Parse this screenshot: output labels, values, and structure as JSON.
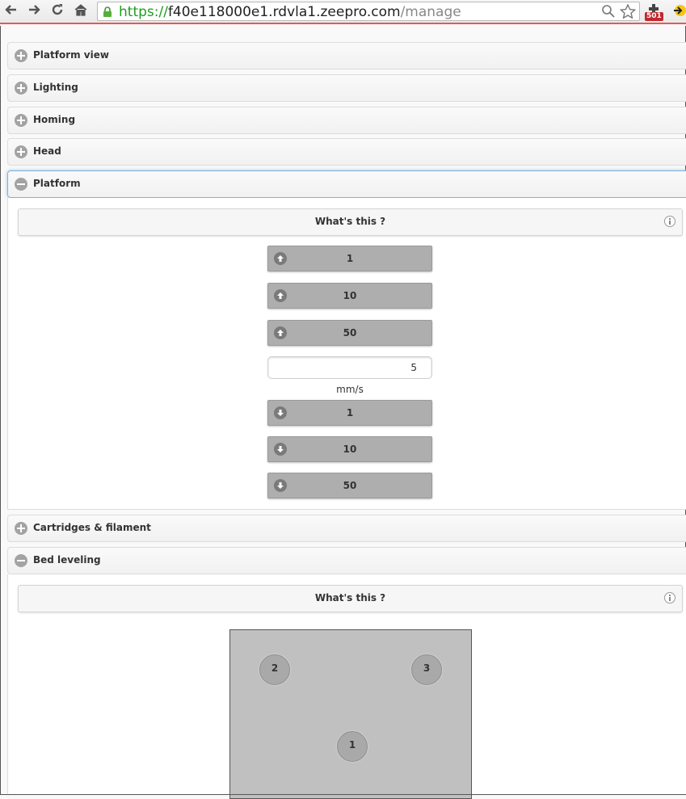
{
  "browser": {
    "url_scheme": "https://",
    "url_host": "f40e118000e1.rdvla1.zeepro.com",
    "url_path": "/manage",
    "extension_badge": "501"
  },
  "panels": [
    {
      "title": "Platform view",
      "state": "collapsed"
    },
    {
      "title": "Lighting",
      "state": "collapsed"
    },
    {
      "title": "Homing",
      "state": "collapsed"
    },
    {
      "title": "Head",
      "state": "collapsed"
    },
    {
      "title": "Platform",
      "state": "expanded"
    },
    {
      "title": "Cartridges & filament",
      "state": "collapsed"
    },
    {
      "title": "Bed leveling",
      "state": "expanded"
    }
  ],
  "platform": {
    "help_label": "What's this ?",
    "up_buttons": [
      "1",
      "10",
      "50"
    ],
    "speed_value": "5",
    "speed_unit": "mm/s",
    "down_buttons": [
      "1",
      "10",
      "50"
    ]
  },
  "bed_leveling": {
    "help_label": "What's this ?",
    "points": [
      "2",
      "3",
      "1"
    ]
  },
  "colors": {
    "accent_border": "#7fb0d8",
    "button_bg": "#aeaeae",
    "bed_bg": "#c0c0c0",
    "url_scheme": "#1a9e1a"
  }
}
